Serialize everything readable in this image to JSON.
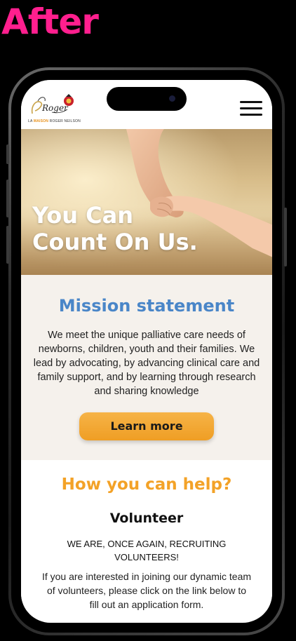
{
  "banner": {
    "label": "After"
  },
  "header": {
    "logo_script": "Roger",
    "logo_prefix": "LA ",
    "logo_accent": "MAISON",
    "logo_suffix": " ROGER NEILSON",
    "menu_icon": "hamburger-menu-icon"
  },
  "hero": {
    "title_line1": "You Can",
    "title_line2": "Count On Us."
  },
  "mission": {
    "heading": "Mission statement",
    "body": "We meet the unique palliative care needs of newborns, children, youth and their families. We lead by advocating, by advancing clinical care and family support, and by learning through research and sharing knowledge",
    "button_label": "Learn more"
  },
  "help": {
    "heading": "How you can help?",
    "subheading": "Volunteer",
    "announcement": "WE ARE, ONCE AGAIN, RECRUITING VOLUNTEERS!",
    "body": "If you are interested in joining our dynamic team of volunteers, please click on the link below to fill out an application form."
  },
  "colors": {
    "banner": "#ff1f8e",
    "mission_heading": "#4a86c8",
    "help_heading": "#f3a227",
    "button": "#f2a733",
    "mission_bg": "#f5f1ec"
  }
}
